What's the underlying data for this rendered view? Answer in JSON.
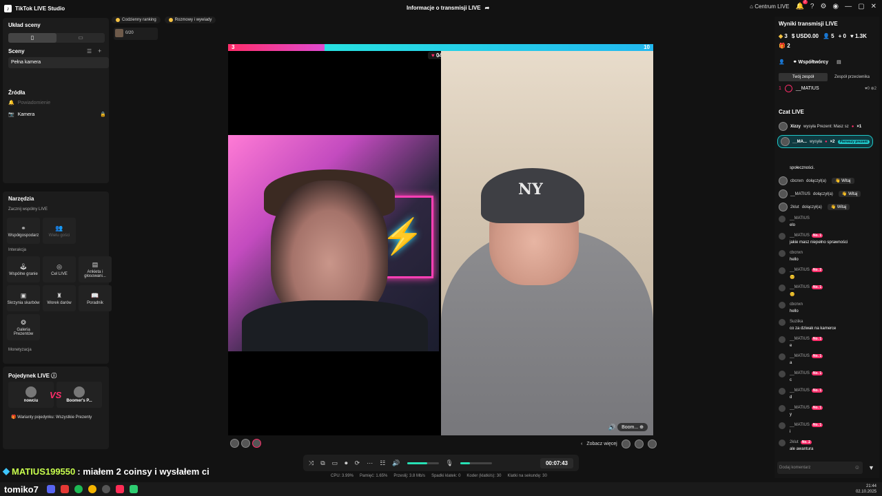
{
  "app": {
    "title": "TikTok LIVE Studio",
    "stream_info": "Informacje o transmisji LIVE",
    "center_live": "Centrum LIVE",
    "notifications": "7"
  },
  "left": {
    "scene_layout": "Układ sceny",
    "scenes_title": "Sceny",
    "scene_item": "Pełna kamera",
    "sources_title": "Źródła",
    "sources": [
      "Powiadomienie",
      "Kamera"
    ],
    "tools_title": "Narzędzia",
    "start_joint": "Zacznij wspólny LIVE",
    "cohost": "Współgospodarz",
    "multi_guest": "Wielu gości",
    "interaction": "Interakcja",
    "interaction_tools": [
      "Wspólne granie",
      "Cel LIVE",
      "Ankieta i głosowani...",
      "Skrzynia skarbów",
      "Worek darów",
      "Poradnik",
      "Galeria Prezentów"
    ],
    "monetization": "Monetyzacja",
    "duel_title": "Pojedynek LIVE",
    "duel_players": [
      "nowciu",
      "Boomer's P..."
    ],
    "vs": "VS",
    "duel_variants": "Warianty pojedynku: Wszystkie Prezenty"
  },
  "center": {
    "rank_pills": [
      "Codzienny ranking",
      "Rozmowy i wywiady"
    ],
    "mini_thumb_text": "0/20",
    "score_left": "3",
    "score_right": "10",
    "timer": "04:07",
    "boom_label": "Boom...",
    "see_more": "Zobacz więcej",
    "elapsed": "00:07:43",
    "volume_level": 0.65,
    "mic_level": 0.3,
    "stats": [
      "CPU: 3.99%",
      "Pamięć: 1.65%",
      "Przeslij: 3.8 Mb/s",
      "Spadki klatek: 0",
      "Koder (klatki/s): 30",
      "Klatki na sekundę: 30"
    ]
  },
  "right": {
    "results_title": "Wyniki transmisji LIVE",
    "metrics": [
      "3",
      "USD0.00",
      "5",
      "0",
      "1.3K",
      "2"
    ],
    "cohosts": "Współtwórcy",
    "team_tabs": [
      "Twój zespół",
      "Zespół przeciwnika"
    ],
    "team_member": "__MATIUS",
    "team_stats": [
      "0",
      "2"
    ],
    "chat_title": "Czat LIVE",
    "gift_rows": [
      {
        "user": "Xizzy",
        "text": "wysyła Prezent: Masz sz",
        "count": "×1"
      },
      {
        "user": "__MA...",
        "text": "wysyła",
        "count": "×2",
        "tag": "Pierwszy prezent"
      }
    ],
    "community": "społeczności.",
    "joins": [
      {
        "user": "cbcnxn",
        "text": "dołączył(a)",
        "btn": "Witaj"
      },
      {
        "user": "__MATIUS",
        "text": "dołączył(a)",
        "btn": "Witaj"
      },
      {
        "user": "2klut",
        "text": "dołączył(a)",
        "btn": "Witaj"
      }
    ],
    "messages": [
      {
        "user": "__MATIUS",
        "rank": "",
        "msg": "elo"
      },
      {
        "user": "__MATIUS",
        "rank": "No. 1",
        "msg": "jakie masz niepełno sprawności"
      },
      {
        "user": "cbcnxn",
        "rank": "",
        "msg": "hello"
      },
      {
        "user": "__MATIUS",
        "rank": "No. 2",
        "msg": "😊"
      },
      {
        "user": "__MATIUS",
        "rank": "No. 1",
        "msg": "😊"
      },
      {
        "user": "cbcnxn",
        "rank": "",
        "msg": "hello"
      },
      {
        "user": "Suziika",
        "rank": "",
        "msg": "co za dziwak na kamerce"
      },
      {
        "user": "__MATIUS",
        "rank": "No. 1",
        "msg": "e"
      },
      {
        "user": "__MATIUS",
        "rank": "No. 1",
        "msg": "a"
      },
      {
        "user": "__MATIUS",
        "rank": "No. 1",
        "msg": "c"
      },
      {
        "user": "__MATIUS",
        "rank": "No. 1",
        "msg": "d"
      },
      {
        "user": "__MATIUS",
        "rank": "No. 1",
        "msg": "y"
      },
      {
        "user": "__MATIUS",
        "rank": "No. 1",
        "msg": "i"
      },
      {
        "user": "2klut",
        "rank": "No. 2",
        "msg": "ale awantura"
      }
    ],
    "comment_placeholder": "Dodaj komentarz"
  },
  "overlay": {
    "name": "MATIUS199550",
    "text": ": miałem 2 coinsy i wysłałem ci"
  },
  "taskbar": {
    "streamer": "tomiko7",
    "time": "21:44",
    "date": "02.10.2025"
  }
}
